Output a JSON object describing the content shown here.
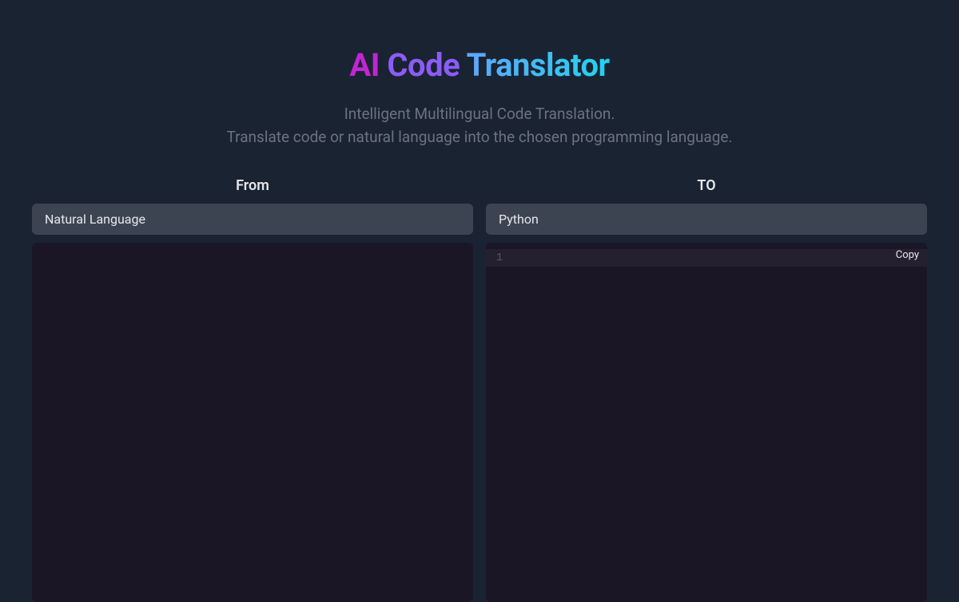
{
  "header": {
    "title_word_1": "AI",
    "title_word_2": "Code",
    "title_word_3": "Translator",
    "subtitle_line_1": "Intelligent Multilingual Code Translation.",
    "subtitle_line_2": "Translate code or natural language into the chosen programming language."
  },
  "from_panel": {
    "label": "From",
    "selected_language": "Natural Language",
    "content": ""
  },
  "to_panel": {
    "label": "TO",
    "selected_language": "Python",
    "line_number": "1",
    "copy_button": "Copy",
    "content": ""
  }
}
